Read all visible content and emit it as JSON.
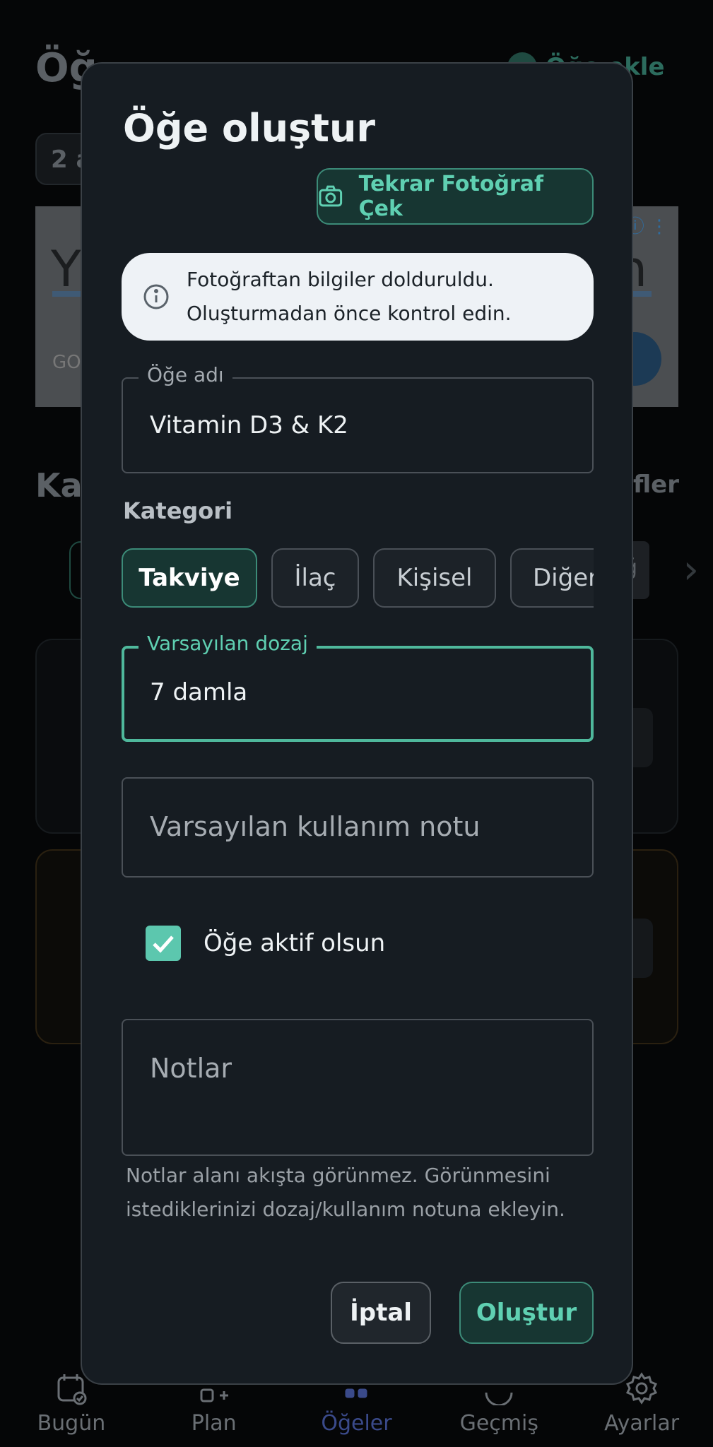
{
  "background": {
    "page_title": "Öğeler",
    "page_title_visible": "Öğ",
    "add_button_label": "Öğe ekle",
    "add_button_visible": "Öğe ekle",
    "filter_pill_visible": "2 a",
    "ad_left_visible": "Y",
    "ad_right_visible": "n",
    "ad_footer_visible": "GO",
    "section_title_visible": "Ka",
    "filters_visible": "ifler",
    "chip_right_visible": "ğ"
  },
  "dialog": {
    "title": "Öğe oluştur",
    "retake_button": "Tekrar Fotoğraf Çek",
    "notice": {
      "line1": "Fotoğraftan bilgiler dolduruldu.",
      "line2": "Oluşturmadan önce kontrol edin."
    },
    "name_field": {
      "label": "Öğe adı",
      "value": "Vitamin D3 & K2"
    },
    "category": {
      "label": "Kategori",
      "chips": [
        "Takviye",
        "İlaç",
        "Kişisel",
        "Diğer"
      ],
      "selected": "Takviye"
    },
    "dosage_field": {
      "label": "Varsayılan dozaj",
      "value": "7 damla"
    },
    "usage_note_field": {
      "placeholder": "Varsayılan kullanım notu"
    },
    "active_checkbox": {
      "label": "Öğe aktif olsun",
      "checked": true
    },
    "notes_field": {
      "placeholder": "Notlar"
    },
    "helper": {
      "line1": "Notlar alanı akışta görünmez. Görünmesini",
      "line2": "istediklerinizi dozaj/kullanım notuna ekleyin."
    },
    "cancel_button": "İptal",
    "create_button": "Oluştur"
  },
  "bottom_nav": {
    "items": [
      {
        "label": "Bugün",
        "icon": "calendar-check-icon"
      },
      {
        "label": "Plan",
        "icon": "plan-add-icon"
      },
      {
        "label": "Öğeler",
        "icon": "items-icon",
        "active": true
      },
      {
        "label": "Geçmiş",
        "icon": "history-icon"
      },
      {
        "label": "Ayarlar",
        "icon": "gear-icon"
      }
    ]
  },
  "colors": {
    "accent": "#5fd0b2",
    "accent_bg": "#173632",
    "dialog_bg": "#161c22",
    "notice_bg": "#eef2f6"
  }
}
